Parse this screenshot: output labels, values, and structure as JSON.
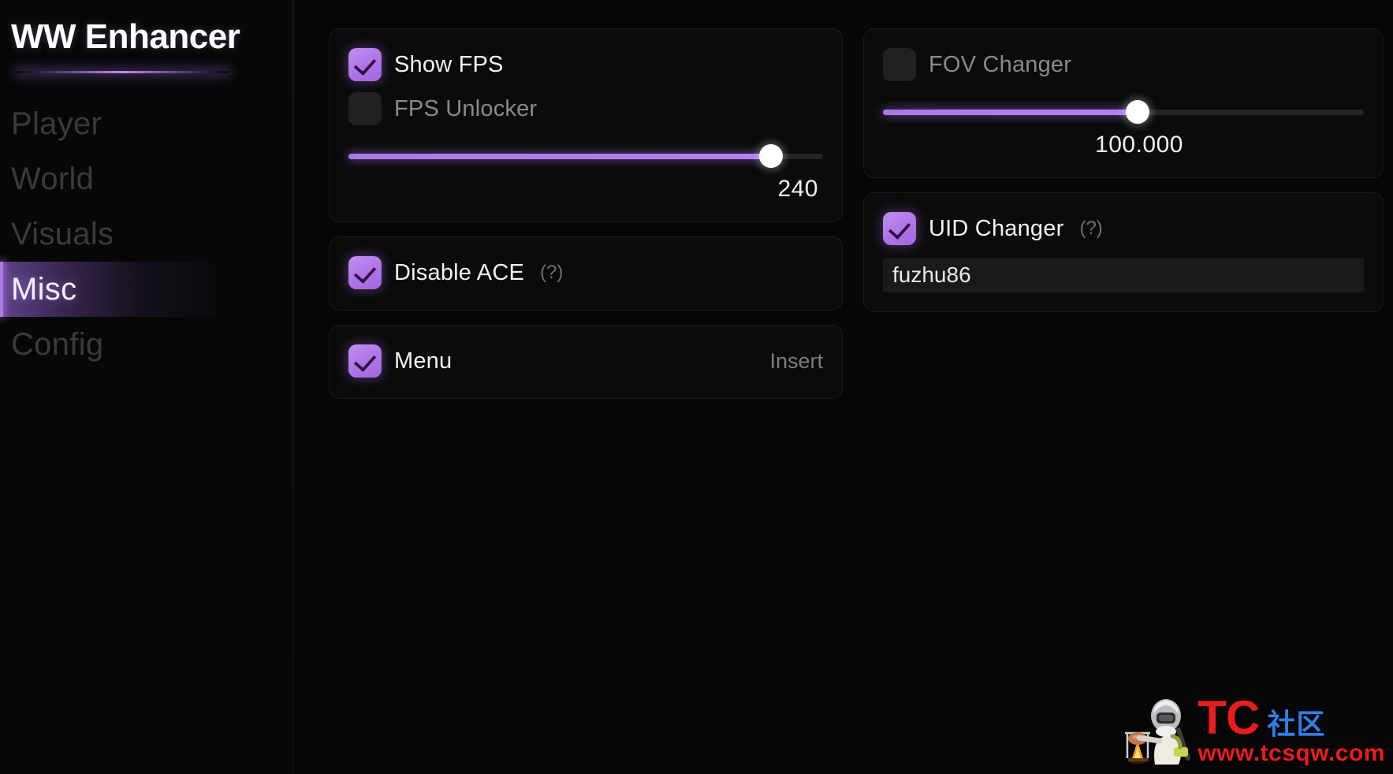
{
  "app": {
    "title": "WW Enhancer"
  },
  "sidebar": {
    "items": [
      {
        "label": "Player",
        "active": false
      },
      {
        "label": "World",
        "active": false
      },
      {
        "label": "Visuals",
        "active": false
      },
      {
        "label": "Misc",
        "active": true
      },
      {
        "label": "Config",
        "active": false
      }
    ]
  },
  "colors": {
    "accent": "#b074e6",
    "accent_light": "#c08ff0",
    "background": "#060606",
    "panel": "#0b0b0b",
    "panel_border": "#1b1b1b",
    "text": "#f2f2f2",
    "text_dim": "#8a8a8a",
    "watermark_red": "#e81d1d",
    "watermark_blue": "#2f7fe8"
  },
  "main": {
    "left_column": {
      "fps_panel": {
        "show_fps": {
          "label": "Show FPS",
          "checked": true
        },
        "fps_unlocker": {
          "label": "FPS Unlocker",
          "checked": false
        },
        "fps_slider": {
          "value": "240",
          "percent": 89
        }
      },
      "ace_panel": {
        "disable_ace": {
          "label": "Disable ACE",
          "checked": true,
          "help": "(?)"
        }
      },
      "menu_panel": {
        "menu": {
          "label": "Menu",
          "checked": true,
          "keybind": "Insert"
        }
      }
    },
    "right_column": {
      "fov_panel": {
        "fov_changer": {
          "label": "FOV Changer",
          "checked": false
        },
        "fov_slider": {
          "value": "100.000",
          "percent": 53
        }
      },
      "uid_panel": {
        "uid_changer": {
          "label": "UID Changer",
          "checked": true,
          "help": "(?)"
        },
        "uid_input": {
          "value": "fuzhu86",
          "placeholder": ""
        }
      }
    }
  },
  "watermark": {
    "brand": "TC",
    "brand_cn": "社区",
    "url": "www.tcsqw.com"
  }
}
